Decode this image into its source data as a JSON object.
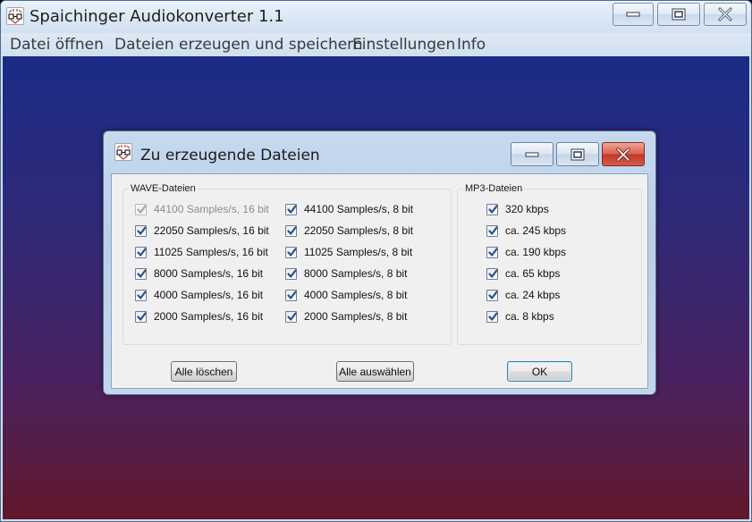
{
  "main_window": {
    "title": "Spaichinger Audiokonverter 1.1",
    "menu": [
      {
        "label": "Datei öffnen"
      },
      {
        "label": "Dateien erzeugen und speichern"
      },
      {
        "label": "Einstellungen"
      },
      {
        "label": "Info"
      }
    ]
  },
  "dialog": {
    "title": "Zu erzeugende Dateien",
    "wave_group": {
      "title": "WAVE-Dateien",
      "col16": [
        {
          "label": "44100 Samples/s, 16 bit",
          "checked": true,
          "disabled": true
        },
        {
          "label": "22050 Samples/s, 16 bit",
          "checked": true,
          "disabled": false
        },
        {
          "label": "11025 Samples/s, 16 bit",
          "checked": true,
          "disabled": false
        },
        {
          "label": "8000 Samples/s, 16 bit",
          "checked": true,
          "disabled": false
        },
        {
          "label": "4000 Samples/s, 16 bit",
          "checked": true,
          "disabled": false
        },
        {
          "label": "2000 Samples/s, 16 bit",
          "checked": true,
          "disabled": false
        }
      ],
      "col8": [
        {
          "label": "44100 Samples/s, 8 bit",
          "checked": true,
          "disabled": false
        },
        {
          "label": "22050 Samples/s, 8 bit",
          "checked": true,
          "disabled": false
        },
        {
          "label": "11025 Samples/s, 8 bit",
          "checked": true,
          "disabled": false
        },
        {
          "label": "8000 Samples/s, 8 bit",
          "checked": true,
          "disabled": false
        },
        {
          "label": "4000 Samples/s, 8 bit",
          "checked": true,
          "disabled": false
        },
        {
          "label": "2000 Samples/s, 8 bit",
          "checked": true,
          "disabled": false
        }
      ]
    },
    "mp3_group": {
      "title": "MP3-Dateien",
      "items": [
        {
          "label": "320 kbps",
          "checked": true,
          "disabled": false
        },
        {
          "label": "ca. 245 kbps",
          "checked": true,
          "disabled": false
        },
        {
          "label": "ca. 190 kbps",
          "checked": true,
          "disabled": false
        },
        {
          "label": "ca. 65  kbps",
          "checked": true,
          "disabled": false
        },
        {
          "label": "ca. 24 kbps",
          "checked": true,
          "disabled": false
        },
        {
          "label": "ca. 8 kbps",
          "checked": true,
          "disabled": false
        }
      ]
    },
    "buttons": {
      "clear_all": "Alle löschen",
      "select_all": "Alle auswählen",
      "ok": "OK"
    }
  },
  "colors": {
    "background_top": "#1b2b86",
    "background_bottom": "#62172b",
    "close_button": "#c8402f",
    "checkmark": "#2a4f8c"
  },
  "icons": {
    "app": "app-logo-icon",
    "minimize": "minimize-icon",
    "maximize": "maximize-icon",
    "close": "close-icon",
    "check": "checkmark-icon"
  }
}
